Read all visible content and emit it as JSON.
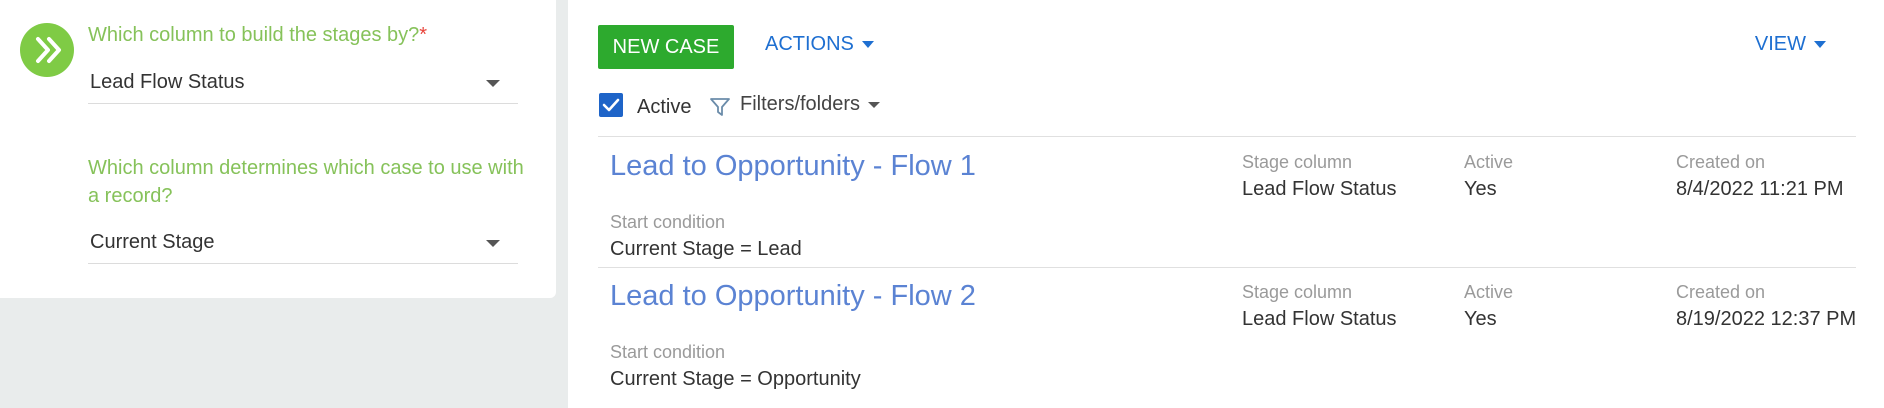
{
  "stage_settings": {
    "question1": "Which column to build the stages by?",
    "required_mark": "*",
    "select1_value": "Lead Flow Status",
    "question2": "Which column determines which case to use with a record?",
    "select2_value": "Current Stage"
  },
  "toolbar": {
    "new_case_label": "NEW CASE",
    "actions_label": "ACTIONS",
    "view_label": "VIEW"
  },
  "filters": {
    "active_label": "Active",
    "active_checked": true,
    "filters_label": "Filters/folders"
  },
  "records": [
    {
      "title": "Lead to Opportunity - Flow 1",
      "stage_column_label": "Stage column",
      "stage_column_value": "Lead Flow Status",
      "active_label": "Active",
      "active_value": "Yes",
      "created_label": "Created on",
      "created_value": "8/4/2022 11:21 PM",
      "start_condition_label": "Start condition",
      "start_condition_value": "Current Stage = Lead"
    },
    {
      "title": "Lead to Opportunity - Flow 2",
      "stage_column_label": "Stage column",
      "stage_column_value": "Lead Flow Status",
      "active_label": "Active",
      "active_value": "Yes",
      "created_label": "Created on",
      "created_value": "8/19/2022 12:37 PM",
      "start_condition_label": "Start condition",
      "start_condition_value": "Current Stage = Opportunity"
    }
  ],
  "colors": {
    "accent_green": "#2daa2e",
    "link_blue": "#1e6fd1",
    "title_blue": "#5b83d3",
    "label_green": "#86c25a"
  }
}
